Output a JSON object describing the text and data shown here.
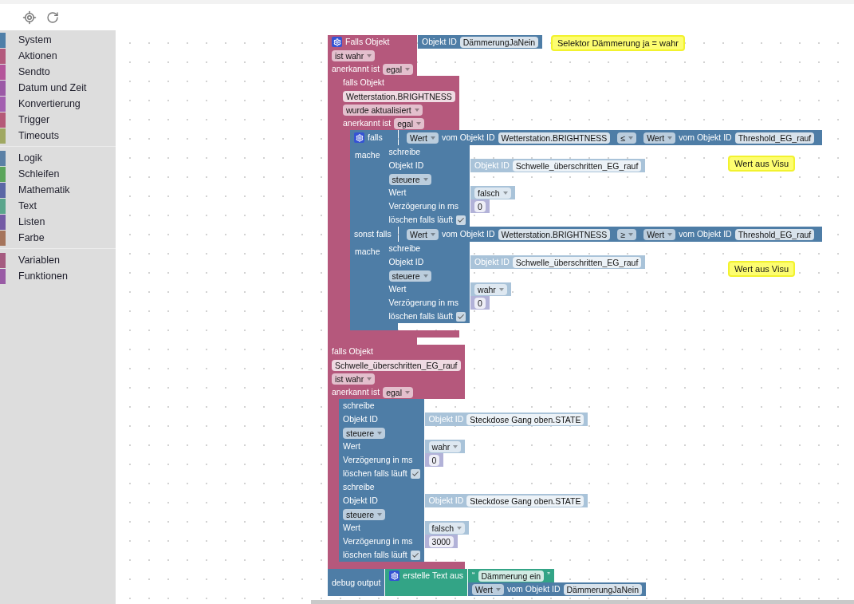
{
  "toolbox": [
    {
      "items": [
        {
          "label": "System",
          "color": "#4f7fa8"
        },
        {
          "label": "Aktionen",
          "color": "#b35a7d"
        },
        {
          "label": "Sendto",
          "color": "#b4559a"
        },
        {
          "label": "Datum und Zeit",
          "color": "#9b59a6"
        },
        {
          "label": "Konvertierung",
          "color": "#a35fb0"
        },
        {
          "label": "Trigger",
          "color": "#b55a78"
        },
        {
          "label": "Timeouts",
          "color": "#a0a862"
        }
      ]
    },
    {
      "items": [
        {
          "label": "Logik",
          "color": "#5b80a5"
        },
        {
          "label": "Schleifen",
          "color": "#5ba55b"
        },
        {
          "label": "Mathematik",
          "color": "#5b67a5"
        },
        {
          "label": "Text",
          "color": "#5ba58c"
        },
        {
          "label": "Listen",
          "color": "#745ba5"
        },
        {
          "label": "Farbe",
          "color": "#a5745b"
        }
      ]
    },
    {
      "items": [
        {
          "label": "Variablen",
          "color": "#a55b80"
        },
        {
          "label": "Funktionen",
          "color": "#995ba5"
        }
      ]
    }
  ],
  "blocks": [
    {
      "kind": "event",
      "rows": [
        {
          "kind": "line",
          "parts": [
            {
              "kind": "gear"
            },
            {
              "kind": "label",
              "text": "Falls Objekt"
            }
          ],
          "input": {
            "kind": "object",
            "rows": [
              {
                "kind": "line",
                "parts": [
                  {
                    "kind": "label",
                    "text": "Objekt ID"
                  },
                  {
                    "kind": "field",
                    "text": "DämmerungJaNein"
                  }
                ]
              }
            ]
          }
        },
        {
          "kind": "line",
          "parts": [
            {
              "kind": "dropdown",
              "text": "ist wahr"
            }
          ]
        },
        {
          "kind": "line",
          "parts": [
            {
              "kind": "label",
              "text": "anerkannt ist"
            },
            {
              "kind": "dropdown",
              "text": "egal"
            }
          ]
        },
        {
          "kind": "statement",
          "blocks": [
            {
              "kind": "event",
              "rows": [
                {
                  "kind": "line",
                  "parts": [
                    {
                      "kind": "label",
                      "text": "falls Objekt"
                    }
                  ]
                },
                {
                  "kind": "line",
                  "parts": [
                    {
                      "kind": "field",
                      "text": "Wetterstation.BRIGHTNESS"
                    }
                  ]
                },
                {
                  "kind": "line",
                  "parts": [
                    {
                      "kind": "dropdown",
                      "text": "wurde aktualisiert"
                    }
                  ]
                },
                {
                  "kind": "line",
                  "parts": [
                    {
                      "kind": "label",
                      "text": "anerkannt ist"
                    },
                    {
                      "kind": "dropdown",
                      "text": "egal"
                    }
                  ]
                },
                {
                  "kind": "statement",
                  "blocks": [
                    {
                      "kind": "logic",
                      "rows": [
                        {
                          "kind": "line",
                          "parts": [
                            {
                              "kind": "gear"
                            },
                            {
                              "kind": "label",
                              "text": "falls"
                            }
                          ],
                          "input": {
                            "kind": "logic",
                            "rows": [
                              {
                                "kind": "line",
                                "parts": [
                                  {
                                    "kind": "block",
                                    "block": {
                                      "kind": "action",
                                      "rows": [
                                        {
                                          "kind": "line",
                                          "parts": [
                                            {
                                              "kind": "dropdown",
                                              "text": "Wert"
                                            },
                                            {
                                              "kind": "label",
                                              "text": "vom Objekt ID"
                                            },
                                            {
                                              "kind": "field",
                                              "text": "Wetterstation.BRIGHTNESS"
                                            }
                                          ]
                                        }
                                      ]
                                    }
                                  },
                                  {
                                    "kind": "dropdown",
                                    "text": "≤"
                                  },
                                  {
                                    "kind": "block",
                                    "block": {
                                      "kind": "action",
                                      "rows": [
                                        {
                                          "kind": "line",
                                          "parts": [
                                            {
                                              "kind": "dropdown",
                                              "text": "Wert"
                                            },
                                            {
                                              "kind": "label",
                                              "text": "vom Objekt ID"
                                            },
                                            {
                                              "kind": "field",
                                              "text": "Threshold_EG_rauf"
                                            }
                                          ]
                                        }
                                      ]
                                    }
                                  }
                                ]
                              }
                            ]
                          }
                        },
                        {
                          "kind": "statement",
                          "label": "mache",
                          "blocks": [
                            {
                              "kind": "action",
                              "rows": [
                                {
                                  "kind": "line",
                                  "parts": [
                                    {
                                      "kind": "label",
                                      "text": "schreibe"
                                    }
                                  ]
                                },
                                {
                                  "kind": "line",
                                  "parts": [
                                    {
                                      "kind": "label",
                                      "text": "Objekt ID"
                                    }
                                  ],
                                  "input": {
                                    "kind": "ghost",
                                    "rows": [
                                      {
                                        "kind": "line",
                                        "parts": [
                                          {
                                            "kind": "label",
                                            "text": "Objekt ID"
                                          },
                                          {
                                            "kind": "field",
                                            "text": "Schwelle_überschritten_EG_rauf"
                                          }
                                        ]
                                      }
                                    ]
                                  }
                                },
                                {
                                  "kind": "line",
                                  "parts": [
                                    {
                                      "kind": "dropdown",
                                      "text": "steuere"
                                    }
                                  ]
                                },
                                {
                                  "kind": "line",
                                  "parts": [
                                    {
                                      "kind": "label",
                                      "text": "Wert"
                                    }
                                  ],
                                  "input": {
                                    "kind": "ghost",
                                    "rows": [
                                      {
                                        "kind": "line",
                                        "parts": [
                                          {
                                            "kind": "dropdown",
                                            "text": "falsch"
                                          }
                                        ]
                                      }
                                    ]
                                  }
                                },
                                {
                                  "kind": "line",
                                  "parts": [
                                    {
                                      "kind": "label",
                                      "text": "Verzögerung in ms"
                                    }
                                  ],
                                  "input": {
                                    "kind": "number",
                                    "rows": [
                                      {
                                        "kind": "line",
                                        "parts": [
                                          {
                                            "kind": "field",
                                            "text": "0"
                                          }
                                        ]
                                      }
                                    ]
                                  }
                                },
                                {
                                  "kind": "line",
                                  "parts": [
                                    {
                                      "kind": "label",
                                      "text": "löschen falls läuft"
                                    },
                                    {
                                      "kind": "check",
                                      "checked": true
                                    }
                                  ]
                                }
                              ]
                            }
                          ]
                        },
                        {
                          "kind": "line",
                          "parts": [
                            {
                              "kind": "label",
                              "text": "sonst falls"
                            }
                          ],
                          "input": {
                            "kind": "logic",
                            "rows": [
                              {
                                "kind": "line",
                                "parts": [
                                  {
                                    "kind": "block",
                                    "block": {
                                      "kind": "action",
                                      "rows": [
                                        {
                                          "kind": "line",
                                          "parts": [
                                            {
                                              "kind": "dropdown",
                                              "text": "Wert"
                                            },
                                            {
                                              "kind": "label",
                                              "text": "vom Objekt ID"
                                            },
                                            {
                                              "kind": "field",
                                              "text": "Wetterstation.BRIGHTNESS"
                                            }
                                          ]
                                        }
                                      ]
                                    }
                                  },
                                  {
                                    "kind": "dropdown",
                                    "text": "≥"
                                  },
                                  {
                                    "kind": "block",
                                    "block": {
                                      "kind": "action",
                                      "rows": [
                                        {
                                          "kind": "line",
                                          "parts": [
                                            {
                                              "kind": "dropdown",
                                              "text": "Wert"
                                            },
                                            {
                                              "kind": "label",
                                              "text": "vom Objekt ID"
                                            },
                                            {
                                              "kind": "field",
                                              "text": "Threshold_EG_rauf"
                                            }
                                          ]
                                        }
                                      ]
                                    }
                                  }
                                ]
                              }
                            ]
                          }
                        },
                        {
                          "kind": "statement",
                          "label": "mache",
                          "blocks": [
                            {
                              "kind": "action",
                              "rows": [
                                {
                                  "kind": "line",
                                  "parts": [
                                    {
                                      "kind": "label",
                                      "text": "schreibe"
                                    }
                                  ]
                                },
                                {
                                  "kind": "line",
                                  "parts": [
                                    {
                                      "kind": "label",
                                      "text": "Objekt ID"
                                    }
                                  ],
                                  "input": {
                                    "kind": "ghost",
                                    "rows": [
                                      {
                                        "kind": "line",
                                        "parts": [
                                          {
                                            "kind": "label",
                                            "text": "Objekt ID"
                                          },
                                          {
                                            "kind": "field",
                                            "text": "Schwelle_überschritten_EG_rauf"
                                          }
                                        ]
                                      }
                                    ]
                                  }
                                },
                                {
                                  "kind": "line",
                                  "parts": [
                                    {
                                      "kind": "dropdown",
                                      "text": "steuere"
                                    }
                                  ]
                                },
                                {
                                  "kind": "line",
                                  "parts": [
                                    {
                                      "kind": "label",
                                      "text": "Wert"
                                    }
                                  ],
                                  "input": {
                                    "kind": "ghost",
                                    "rows": [
                                      {
                                        "kind": "line",
                                        "parts": [
                                          {
                                            "kind": "dropdown",
                                            "text": "wahr"
                                          }
                                        ]
                                      }
                                    ]
                                  }
                                },
                                {
                                  "kind": "line",
                                  "parts": [
                                    {
                                      "kind": "label",
                                      "text": "Verzögerung in ms"
                                    }
                                  ],
                                  "input": {
                                    "kind": "number",
                                    "rows": [
                                      {
                                        "kind": "line",
                                        "parts": [
                                          {
                                            "kind": "field",
                                            "text": "0"
                                          }
                                        ]
                                      }
                                    ]
                                  }
                                },
                                {
                                  "kind": "line",
                                  "parts": [
                                    {
                                      "kind": "label",
                                      "text": "löschen falls läuft"
                                    },
                                    {
                                      "kind": "check",
                                      "checked": true
                                    }
                                  ]
                                }
                              ]
                            }
                          ]
                        }
                      ]
                    }
                  ]
                }
              ]
            }
          ]
        }
      ]
    },
    {
      "kind": "event",
      "rows": [
        {
          "kind": "line",
          "parts": [
            {
              "kind": "label",
              "text": "falls Objekt"
            }
          ]
        },
        {
          "kind": "line",
          "parts": [
            {
              "kind": "field",
              "text": "Schwelle_überschritten_EG_rauf"
            }
          ]
        },
        {
          "kind": "line",
          "parts": [
            {
              "kind": "dropdown",
              "text": "ist wahr"
            }
          ]
        },
        {
          "kind": "line",
          "parts": [
            {
              "kind": "label",
              "text": "anerkannt ist"
            },
            {
              "kind": "dropdown",
              "text": "egal"
            }
          ]
        },
        {
          "kind": "statement",
          "blocks": [
            {
              "kind": "action",
              "rows": [
                {
                  "kind": "line",
                  "parts": [
                    {
                      "kind": "label",
                      "text": "schreibe"
                    }
                  ]
                },
                {
                  "kind": "line",
                  "parts": [
                    {
                      "kind": "label",
                      "text": "Objekt ID"
                    }
                  ],
                  "input": {
                    "kind": "ghost",
                    "rows": [
                      {
                        "kind": "line",
                        "parts": [
                          {
                            "kind": "label",
                            "text": "Objekt ID"
                          },
                          {
                            "kind": "field",
                            "text": "Steckdose Gang oben.STATE"
                          }
                        ]
                      }
                    ]
                  }
                },
                {
                  "kind": "line",
                  "parts": [
                    {
                      "kind": "dropdown",
                      "text": "steuere"
                    }
                  ]
                },
                {
                  "kind": "line",
                  "parts": [
                    {
                      "kind": "label",
                      "text": "Wert"
                    }
                  ],
                  "input": {
                    "kind": "ghost",
                    "rows": [
                      {
                        "kind": "line",
                        "parts": [
                          {
                            "kind": "dropdown",
                            "text": "wahr"
                          }
                        ]
                      }
                    ]
                  }
                },
                {
                  "kind": "line",
                  "parts": [
                    {
                      "kind": "label",
                      "text": "Verzögerung in ms"
                    }
                  ],
                  "input": {
                    "kind": "number",
                    "rows": [
                      {
                        "kind": "line",
                        "parts": [
                          {
                            "kind": "field",
                            "text": "0"
                          }
                        ]
                      }
                    ]
                  }
                },
                {
                  "kind": "line",
                  "parts": [
                    {
                      "kind": "label",
                      "text": "löschen falls läuft"
                    },
                    {
                      "kind": "check",
                      "checked": true
                    }
                  ]
                }
              ]
            },
            {
              "kind": "action",
              "rows": [
                {
                  "kind": "line",
                  "parts": [
                    {
                      "kind": "label",
                      "text": "schreibe"
                    }
                  ]
                },
                {
                  "kind": "line",
                  "parts": [
                    {
                      "kind": "label",
                      "text": "Objekt ID"
                    }
                  ],
                  "input": {
                    "kind": "ghost",
                    "rows": [
                      {
                        "kind": "line",
                        "parts": [
                          {
                            "kind": "label",
                            "text": "Objekt ID"
                          },
                          {
                            "kind": "field",
                            "text": "Steckdose Gang oben.STATE"
                          }
                        ]
                      }
                    ]
                  }
                },
                {
                  "kind": "line",
                  "parts": [
                    {
                      "kind": "dropdown",
                      "text": "steuere"
                    }
                  ]
                },
                {
                  "kind": "line",
                  "parts": [
                    {
                      "kind": "label",
                      "text": "Wert"
                    }
                  ],
                  "input": {
                    "kind": "ghost",
                    "rows": [
                      {
                        "kind": "line",
                        "parts": [
                          {
                            "kind": "dropdown",
                            "text": "falsch"
                          }
                        ]
                      }
                    ]
                  }
                },
                {
                  "kind": "line",
                  "parts": [
                    {
                      "kind": "label",
                      "text": "Verzögerung in ms"
                    }
                  ],
                  "input": {
                    "kind": "number",
                    "rows": [
                      {
                        "kind": "line",
                        "parts": [
                          {
                            "kind": "field",
                            "text": "3000"
                          }
                        ]
                      }
                    ]
                  }
                },
                {
                  "kind": "line",
                  "parts": [
                    {
                      "kind": "label",
                      "text": "löschen falls läuft"
                    },
                    {
                      "kind": "check",
                      "checked": true
                    }
                  ]
                }
              ]
            }
          ]
        }
      ]
    },
    {
      "kind": "action",
      "rows": [
        {
          "kind": "line",
          "parts": [
            {
              "kind": "label",
              "text": "debug output"
            }
          ],
          "input": {
            "kind": "text",
            "rows": [
              {
                "kind": "line",
                "parts": [
                  {
                    "kind": "gear"
                  },
                  {
                    "kind": "label",
                    "text": "erstelle Text aus"
                  }
                ],
                "input": {
                  "kind": "text",
                  "rows": [
                    {
                      "kind": "line",
                      "parts": [
                        {
                          "kind": "label",
                          "text": "“"
                        },
                        {
                          "kind": "field",
                          "text": "Dämmerung ein"
                        },
                        {
                          "kind": "label",
                          "text": "”"
                        }
                      ]
                    }
                  ]
                }
              },
              {
                "kind": "line",
                "parts": [],
                "input": {
                  "kind": "action",
                  "rows": [
                    {
                      "kind": "line",
                      "parts": [
                        {
                          "kind": "dropdown",
                          "text": "Wert"
                        },
                        {
                          "kind": "label",
                          "text": "vom Objekt ID"
                        },
                        {
                          "kind": "field",
                          "text": "DämmerungJaNein"
                        }
                      ]
                    }
                  ]
                }
              }
            ]
          }
        }
      ]
    }
  ],
  "comments": [
    {
      "text": "Selektor Dämmerung ja = wahr"
    },
    {
      "text": "Wert aus Visu"
    },
    {
      "text": "Wert aus Visu"
    }
  ]
}
